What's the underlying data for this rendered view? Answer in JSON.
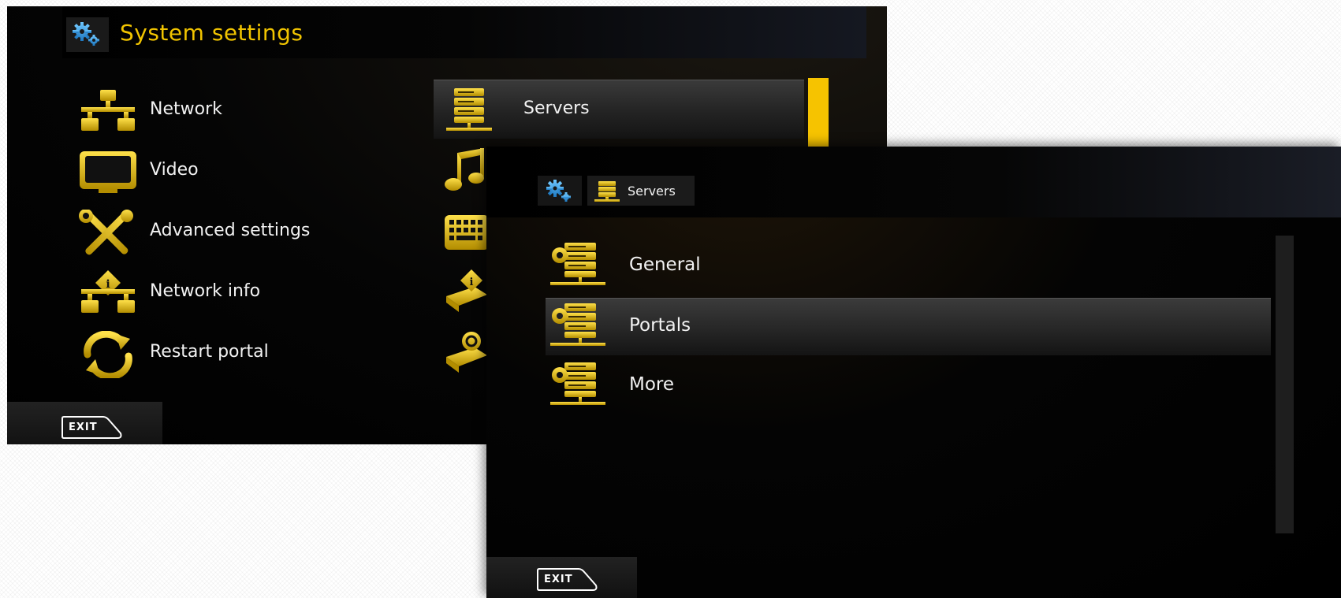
{
  "system_settings": {
    "title": "System settings",
    "menu_left": [
      {
        "label": "Network",
        "icon": "network-icon"
      },
      {
        "label": "Video",
        "icon": "tv-icon"
      },
      {
        "label": "Advanced settings",
        "icon": "tools-icon"
      },
      {
        "label": "Network info",
        "icon": "network-info-icon"
      },
      {
        "label": "Restart portal",
        "icon": "restart-icon"
      }
    ],
    "menu_right_selected": {
      "label": "Servers",
      "icon": "server-icon"
    },
    "menu_right_partial_icons": [
      "music-icon",
      "keyboard-icon",
      "device-info-icon",
      "device-restart-icon"
    ],
    "exit_label": "EXIT"
  },
  "servers_screen": {
    "breadcrumb": [
      "gear-icon",
      "Servers"
    ],
    "items": [
      {
        "label": "General",
        "icon": "server-gear-icon",
        "selected": false
      },
      {
        "label": "Portals",
        "icon": "server-gear-icon",
        "selected": true
      },
      {
        "label": "More",
        "icon": "server-gear-icon",
        "selected": false
      }
    ],
    "exit_label": "EXIT"
  },
  "colors": {
    "accent": "#f1c400",
    "icon_yellow": "#d9b400",
    "gear_blue": "#3aa4e6",
    "background": "#000000",
    "text": "#f2f2f2"
  }
}
